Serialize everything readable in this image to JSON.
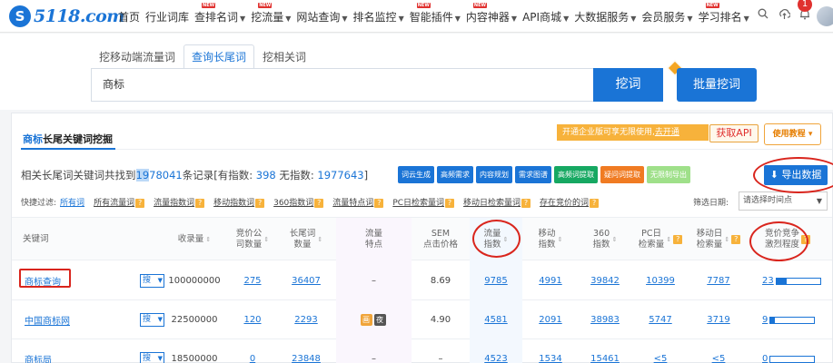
{
  "logo": {
    "mark": "S",
    "text": "5118.com"
  },
  "nav": {
    "items": [
      {
        "label": "首页",
        "dropdown": false,
        "badge": ""
      },
      {
        "label": "行业词库",
        "dropdown": false,
        "badge": ""
      },
      {
        "label": "查排名词",
        "dropdown": true,
        "badge": "NEW"
      },
      {
        "label": "挖流量",
        "dropdown": true,
        "badge": "NEW"
      },
      {
        "label": "网站查询",
        "dropdown": true,
        "badge": ""
      },
      {
        "label": "排名监控",
        "dropdown": true,
        "badge": ""
      },
      {
        "label": "智能插件",
        "dropdown": true,
        "badge": "NEW"
      },
      {
        "label": "内容神器",
        "dropdown": true,
        "badge": "NEW"
      },
      {
        "label": "API商城",
        "dropdown": true,
        "badge": ""
      },
      {
        "label": "大数据服务",
        "dropdown": true,
        "badge": ""
      },
      {
        "label": "会员服务",
        "dropdown": true,
        "badge": ""
      },
      {
        "label": "学习排名",
        "dropdown": true,
        "badge": "NEW"
      }
    ],
    "notification_count": "1"
  },
  "search": {
    "tabs": [
      "挖移动端流量词",
      "查询长尾词",
      "挖相关词"
    ],
    "active_tab": 1,
    "query": "商标",
    "search_button": "挖词",
    "batch_button": "批量挖词"
  },
  "card": {
    "title_keyword": "商标",
    "title_rest": "长尾关键词挖掘",
    "promo_text": "开通企业版可享无限使用,",
    "promo_link": "去开通",
    "api_button": "获取API",
    "tutorial_button": "使用教程",
    "summary": {
      "prefix": "相关长尾词关键词共找到",
      "total_a": "19",
      "total_b": "78041",
      "mid": "条记录[有指数:",
      "with_index": "398",
      "no_index_label": "无指数:",
      "no_index": "1977643",
      "suffix": "]"
    },
    "tools": [
      {
        "label": "词云生成",
        "color": "blue"
      },
      {
        "label": "高频需求",
        "color": "blue"
      },
      {
        "label": "内容规划",
        "color": "blue"
      },
      {
        "label": "需求图谱",
        "color": "blue"
      },
      {
        "label": "高频词提取",
        "color": "green"
      },
      {
        "label": "疑问词提取",
        "color": "orange"
      },
      {
        "label": "无限制导出",
        "color": "lightgreen"
      }
    ],
    "export_button": "导出数据",
    "filter_label": "快捷过滤:",
    "filters": [
      {
        "label": "所有词",
        "active": true
      },
      {
        "label": "所有流量词",
        "active": false
      },
      {
        "label": "流量指数词",
        "active": false
      },
      {
        "label": "移动指数词",
        "active": false
      },
      {
        "label": "360指数词",
        "active": false
      },
      {
        "label": "流量特点词",
        "active": false
      },
      {
        "label": "PC日检索量词",
        "active": false
      },
      {
        "label": "移动日检索量词",
        "active": false
      },
      {
        "label": "存在竞价的词",
        "active": false
      }
    ],
    "date_label": "筛选日期:",
    "date_placeholder": "请选择时间点"
  },
  "table": {
    "headers": {
      "keyword": "关键词",
      "indexed": "收录量",
      "bid_companies": "竞价公\n司数量",
      "longtail": "长尾词\n数量",
      "traffic_feature": "流量\n特点",
      "sem_price": "SEM\n点击价格",
      "traffic_index": "流量\n指数",
      "mobile_index": "移动\n指数",
      "index_360": "360\n指数",
      "pc_search": "PC日\n检索量",
      "mobile_search": "移动日\n检索量",
      "competition": "竞价竞争\n激烈程度"
    },
    "rows": [
      {
        "keyword": "商标查询",
        "sou": "搜",
        "indexed": "100000000",
        "bid_companies": "275",
        "longtail": "36407",
        "feature": "–",
        "feature_tags": [],
        "sem_price": "8.69",
        "traffic_index": "9785",
        "mobile_index": "4991",
        "index_360": "39842",
        "pc_search": "10399",
        "mobile_search": "7787",
        "competition": "23",
        "competition_level": 0.23
      },
      {
        "keyword": "中国商标网",
        "sou": "搜",
        "indexed": "22500000",
        "bid_companies": "120",
        "longtail": "2293",
        "feature": "",
        "feature_tags": [
          "画",
          "夜"
        ],
        "sem_price": "4.90",
        "traffic_index": "4581",
        "mobile_index": "2091",
        "index_360": "38983",
        "pc_search": "5747",
        "mobile_search": "3719",
        "competition": "9",
        "competition_level": 0.09
      },
      {
        "keyword": "商标局",
        "sou": "搜",
        "indexed": "18500000",
        "bid_companies": "0",
        "longtail": "23848",
        "feature": "–",
        "feature_tags": [],
        "sem_price": "–",
        "traffic_index": "4523",
        "mobile_index": "1534",
        "index_360": "15461",
        "pc_search": "<5",
        "mobile_search": "<5",
        "competition": "0",
        "competition_level": 0
      }
    ]
  }
}
